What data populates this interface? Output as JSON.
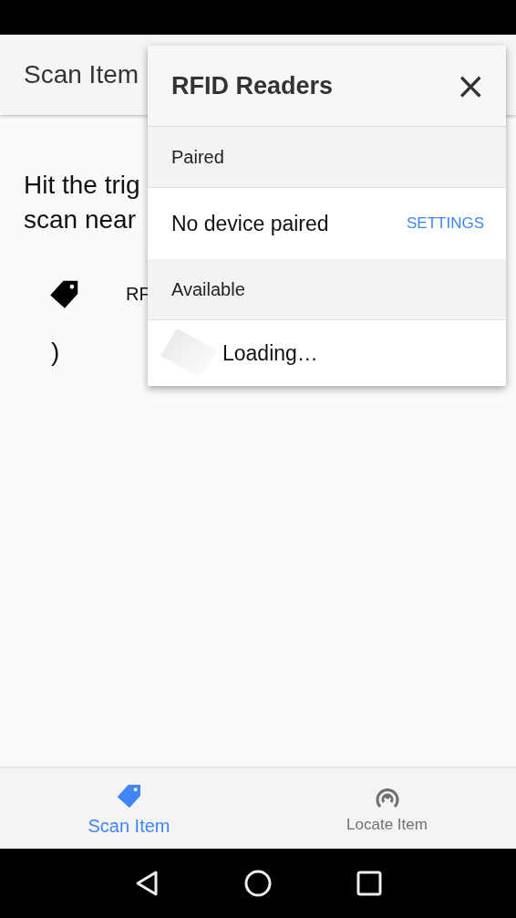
{
  "app_bar": {
    "title": "Scan Item"
  },
  "content": {
    "instruction_lines": [
      "Hit the trig",
      "scan near"
    ],
    "reader_label": "RF",
    "line_2": ")"
  },
  "dialog": {
    "title": "RFID Readers",
    "close": "×",
    "sections": [
      {
        "header": "Paired",
        "kind": "message",
        "text": "No device paired",
        "action": "SETTINGS"
      },
      {
        "header": "Available",
        "kind": "loading",
        "text": "Loading…"
      }
    ]
  },
  "bottom_nav": [
    {
      "label": "Scan Item",
      "selected": true
    },
    {
      "label": "Locate Item",
      "selected": false
    }
  ]
}
